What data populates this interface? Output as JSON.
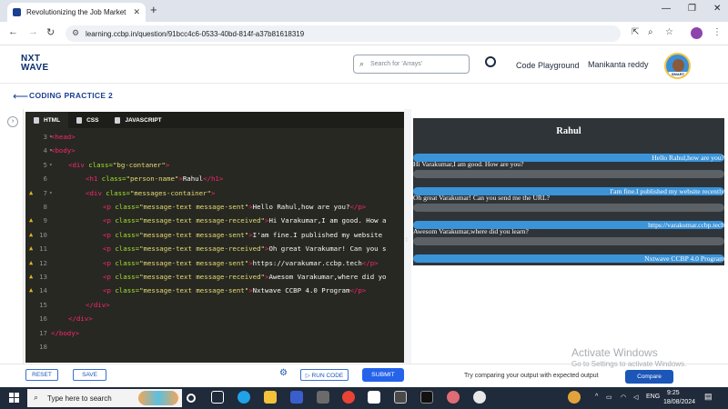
{
  "browser": {
    "tab_title": "Revolutionizing the Job Market",
    "tab_close": "✕",
    "new_tab": "+",
    "url": "learning.ccbp.in/question/91bcc4c6-0533-40bd-814f-a37b81618319",
    "window_controls": [
      "—",
      "❐",
      "✕"
    ]
  },
  "header": {
    "logo_line1": "NXT",
    "logo_line2": "WAVE",
    "search_placeholder": "Search for 'Arrays'",
    "code_playground": "Code Playground",
    "user_name": "Manikanta reddy",
    "avatar_badge": "SMART"
  },
  "practice": {
    "title": "CODING PRACTICE 2"
  },
  "editor": {
    "tabs": [
      "HTML",
      "CSS",
      "JAVASCRIPT"
    ],
    "lines": [
      {
        "n": "3",
        "warn": false,
        "fold": true,
        "indent": 0,
        "parts": [
          [
            "tg",
            "<head>"
          ]
        ]
      },
      {
        "n": "4",
        "warn": false,
        "fold": true,
        "indent": 0,
        "parts": [
          [
            "tg",
            "<body>"
          ]
        ]
      },
      {
        "n": "5",
        "warn": false,
        "fold": true,
        "indent": 1,
        "parts": [
          [
            "tg",
            "<div"
          ],
          [
            "at",
            " class="
          ],
          [
            "sv",
            "\"bg-contaner\""
          ],
          [
            "tg",
            ">"
          ]
        ]
      },
      {
        "n": "6",
        "warn": false,
        "fold": false,
        "indent": 2,
        "parts": [
          [
            "tg",
            "<h1"
          ],
          [
            "at",
            " class="
          ],
          [
            "sv",
            "\"person-name\""
          ],
          [
            "tg",
            ">"
          ],
          [
            "pt",
            "Rahul"
          ],
          [
            "tg",
            "</h1>"
          ]
        ]
      },
      {
        "n": "7",
        "warn": true,
        "fold": true,
        "indent": 2,
        "parts": [
          [
            "tg",
            "<div"
          ],
          [
            "at",
            " class="
          ],
          [
            "sv",
            "\"messages-container\""
          ],
          [
            "tg",
            ">"
          ]
        ]
      },
      {
        "n": "8",
        "warn": false,
        "fold": false,
        "indent": 3,
        "parts": [
          [
            "tg",
            "<p"
          ],
          [
            "at",
            " class="
          ],
          [
            "sv",
            "\"message-text message-sent\""
          ],
          [
            "tg",
            ">"
          ],
          [
            "pt",
            "Hello Rahul,how are you?"
          ],
          [
            "tg",
            "</p>"
          ]
        ]
      },
      {
        "n": "9",
        "warn": true,
        "fold": false,
        "indent": 3,
        "parts": [
          [
            "tg",
            "<p"
          ],
          [
            "at",
            " class="
          ],
          [
            "sv",
            "\"message-text message-received\""
          ],
          [
            "tg",
            ">"
          ],
          [
            "pt",
            "Hi Varakumar,I am good. How a"
          ]
        ]
      },
      {
        "n": "10",
        "warn": true,
        "fold": false,
        "indent": 3,
        "parts": [
          [
            "tg",
            "<p"
          ],
          [
            "at",
            " class="
          ],
          [
            "sv",
            "\"message-text message-sent\""
          ],
          [
            "tg",
            ">"
          ],
          [
            "pt",
            "I'am fine.I published my website"
          ]
        ]
      },
      {
        "n": "11",
        "warn": true,
        "fold": false,
        "indent": 3,
        "parts": [
          [
            "tg",
            "<p"
          ],
          [
            "at",
            " class="
          ],
          [
            "sv",
            "\"message-text message-received\""
          ],
          [
            "tg",
            ">"
          ],
          [
            "pt",
            "Oh great Varakumar! Can you s"
          ]
        ]
      },
      {
        "n": "12",
        "warn": true,
        "fold": false,
        "indent": 3,
        "parts": [
          [
            "tg",
            "<p"
          ],
          [
            "at",
            " class="
          ],
          [
            "sv",
            "\"message-text message-sent\""
          ],
          [
            "tg",
            ">"
          ],
          [
            "pt",
            "https://varakumar.ccbp.tech"
          ],
          [
            "tg",
            "</p>"
          ]
        ]
      },
      {
        "n": "13",
        "warn": true,
        "fold": false,
        "indent": 3,
        "parts": [
          [
            "tg",
            "<p"
          ],
          [
            "at",
            " class="
          ],
          [
            "sv",
            "\"message-text message-received\""
          ],
          [
            "tg",
            ">"
          ],
          [
            "pt",
            "Awesom Varakumar,where did yo"
          ]
        ]
      },
      {
        "n": "14",
        "warn": true,
        "fold": false,
        "indent": 3,
        "parts": [
          [
            "tg",
            "<p"
          ],
          [
            "at",
            " class="
          ],
          [
            "sv",
            "\"message-text message-sent\""
          ],
          [
            "tg",
            ">"
          ],
          [
            "pt",
            "Nxtwave CCBP 4.0 Program"
          ],
          [
            "tg",
            "</p>"
          ]
        ]
      },
      {
        "n": "15",
        "warn": false,
        "fold": false,
        "indent": 2,
        "parts": [
          [
            "tg",
            "</div>"
          ]
        ]
      },
      {
        "n": "16",
        "warn": false,
        "fold": false,
        "indent": 1,
        "parts": [
          [
            "tg",
            "</div>"
          ]
        ]
      },
      {
        "n": "17",
        "warn": false,
        "fold": false,
        "indent": 0,
        "parts": [
          [
            "tg",
            "</body>"
          ]
        ]
      },
      {
        "n": "18",
        "warn": false,
        "fold": false,
        "indent": 0,
        "parts": []
      }
    ]
  },
  "preview": {
    "person_name": "Rahul",
    "messages": [
      {
        "type": "sent",
        "text": "Hello Rahul,how are you?"
      },
      {
        "type": "recv",
        "text": "Hi Varakumar,I am good. How are you?"
      },
      {
        "type": "sent",
        "text": "I'am fine.I published my website recently"
      },
      {
        "type": "recv",
        "text": "Oh great Varakumar! Can you send me the URL?"
      },
      {
        "type": "sent",
        "text": "https://varakumar.ccbp.tech"
      },
      {
        "type": "recv",
        "text": "Awesom Varakumar,where did you learn?"
      },
      {
        "type": "sent",
        "text": "Nxtwave CCBP 4.0 Program"
      }
    ]
  },
  "actions": {
    "reset": "RESET",
    "save": "SAVE",
    "run_code": "▷ RUN CODE",
    "submit": "SUBMIT",
    "try_text": "Try comparing your output with expected output",
    "compare": "Compare",
    "activate_title": "Activate Windows",
    "activate_sub": "Go to Settings to activate Windows."
  },
  "taskbar": {
    "search_text": "Type here to search",
    "lang": "ENG",
    "time": "9:25",
    "date": "18/08/2024"
  },
  "colors": {
    "brand": "#1b3f91",
    "sent_bubble": "#3b93d8",
    "preview_bg": "#2f3438",
    "submit": "#2563eb"
  }
}
